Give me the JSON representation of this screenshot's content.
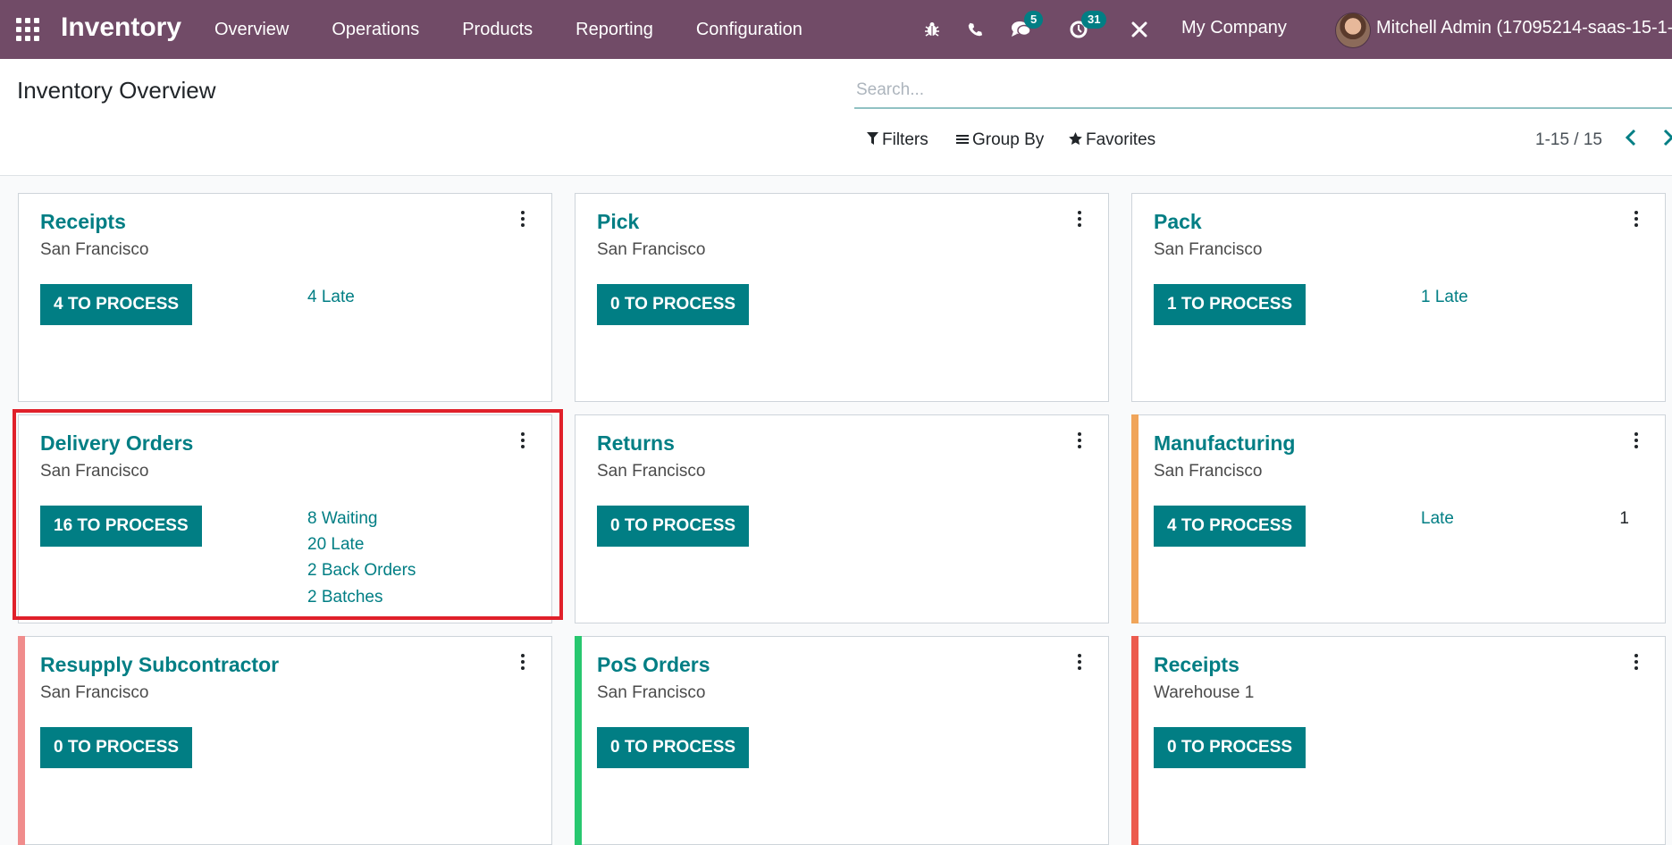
{
  "navbar": {
    "app_title": "Inventory",
    "menu": [
      "Overview",
      "Operations",
      "Products",
      "Reporting",
      "Configuration"
    ],
    "messages_count": "5",
    "activities_count": "31",
    "company": "My Company",
    "user": "Mitchell Admin (17095214-saas-15-1-a",
    "icons": [
      "apps-grid-icon",
      "bug-icon",
      "phone-icon",
      "chat-icon",
      "clock-icon",
      "tools-icon"
    ]
  },
  "control_panel": {
    "title": "Inventory Overview",
    "search_placeholder": "Search...",
    "filters_label": "Filters",
    "groupby_label": "Group By",
    "favorites_label": "Favorites",
    "pager": "1-15 / 15"
  },
  "colors": {
    "brand": "#714b67",
    "accent": "#017e84",
    "stripe_orange": "#f0a55a",
    "stripe_salmon": "#f08c8c",
    "stripe_green": "#28c76f",
    "stripe_red": "#ec5b4e",
    "highlight": "#e0202a"
  },
  "cards": [
    {
      "title": "Receipts",
      "location": "San Francisco",
      "button": "4 TO PROCESS",
      "stats": [
        "4 Late"
      ]
    },
    {
      "title": "Pick",
      "location": "San Francisco",
      "button": "0 TO PROCESS",
      "stats": []
    },
    {
      "title": "Pack",
      "location": "San Francisco",
      "button": "1 TO PROCESS",
      "stats": [
        "1 Late"
      ]
    },
    {
      "title": "Delivery Orders",
      "location": "San Francisco",
      "button": "16 TO PROCESS",
      "stats": [
        "8 Waiting",
        "20 Late",
        "2 Back Orders",
        "2 Batches"
      ],
      "highlighted": true
    },
    {
      "title": "Returns",
      "location": "San Francisco",
      "button": "0 TO PROCESS",
      "stats": []
    },
    {
      "title": "Manufacturing",
      "location": "San Francisco",
      "button": "4 TO PROCESS",
      "stats": [
        "Late"
      ],
      "stat_value": "1",
      "stripe": "orange"
    },
    {
      "title": "Resupply Subcontractor",
      "location": "San Francisco",
      "button": "0 TO PROCESS",
      "stats": [],
      "stripe": "salmon"
    },
    {
      "title": "PoS Orders",
      "location": "San Francisco",
      "button": "0 TO PROCESS",
      "stats": [],
      "stripe": "green"
    },
    {
      "title": "Receipts",
      "location": "Warehouse 1",
      "button": "0 TO PROCESS",
      "stats": [],
      "stripe": "red"
    }
  ]
}
